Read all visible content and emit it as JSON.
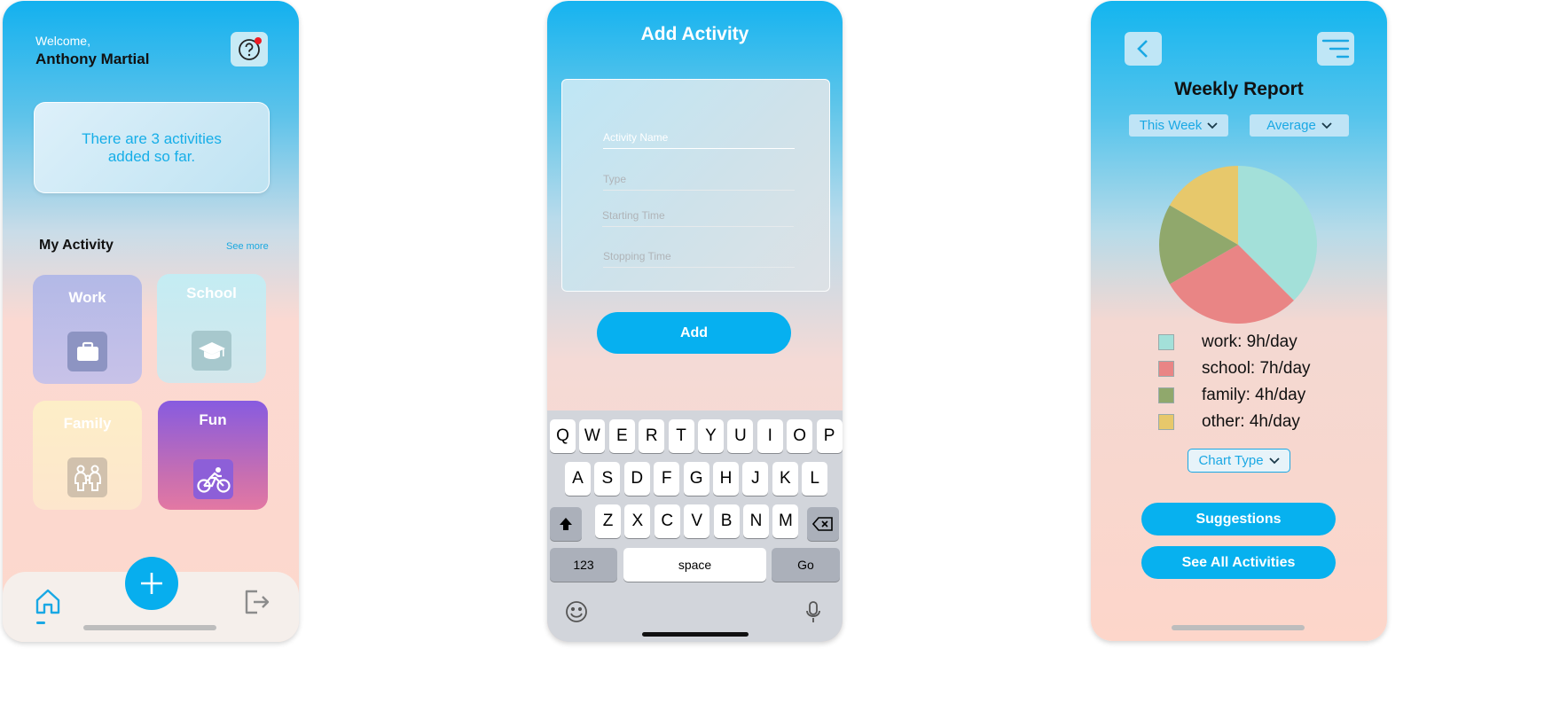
{
  "home": {
    "welcome": "Welcome,",
    "user_name": "Anthony Martial",
    "info_text": "There are 3 activities added so far.",
    "section_title": "My Activity",
    "see_more": "See more",
    "tiles": [
      {
        "label": "Work",
        "icon": "briefcase-icon"
      },
      {
        "label": "School",
        "icon": "graduation-cap-icon"
      },
      {
        "label": "Family",
        "icon": "family-icon"
      },
      {
        "label": "Fun",
        "icon": "bicycle-icon"
      }
    ],
    "tabbar": {
      "home_icon": "home-icon",
      "add_icon": "plus-icon",
      "logout_icon": "logout-icon"
    }
  },
  "add_activity": {
    "title": "Add Activity",
    "fields": [
      {
        "placeholder": "Activity Name"
      },
      {
        "placeholder": "Type"
      },
      {
        "placeholder": "Starting Time"
      },
      {
        "placeholder": "Stopping Time"
      }
    ],
    "add_button": "Add",
    "keyboard": {
      "row1": [
        "Q",
        "W",
        "E",
        "R",
        "T",
        "Y",
        "U",
        "I",
        "O",
        "P"
      ],
      "row2": [
        "A",
        "S",
        "D",
        "F",
        "G",
        "H",
        "J",
        "K",
        "L"
      ],
      "row3": [
        "Z",
        "X",
        "C",
        "V",
        "B",
        "N",
        "M"
      ],
      "numbers": "123",
      "space": "space",
      "go": "Go"
    }
  },
  "report": {
    "title": "Weekly Report",
    "period_dropdown": "This Week",
    "metric_dropdown": "Average",
    "chart_type_dropdown": "Chart Type",
    "suggestions_button": "Suggestions",
    "see_all_button": "See All Activities",
    "colors": {
      "work": "#a3e0d9",
      "school": "#e98585",
      "family": "#90a86c",
      "other": "#e7c86b",
      "accent": "#07b1ef"
    }
  },
  "chart_data": {
    "type": "pie",
    "slices": [
      {
        "label": "work: 9h/day",
        "value": 9,
        "color": "#a3e0d9"
      },
      {
        "label": "school: 7h/day",
        "value": 7,
        "color": "#e98585"
      },
      {
        "label": "family: 4h/day",
        "value": 4,
        "color": "#90a86c"
      },
      {
        "label": "other: 4h/day",
        "value": 4,
        "color": "#e7c86b"
      }
    ]
  }
}
